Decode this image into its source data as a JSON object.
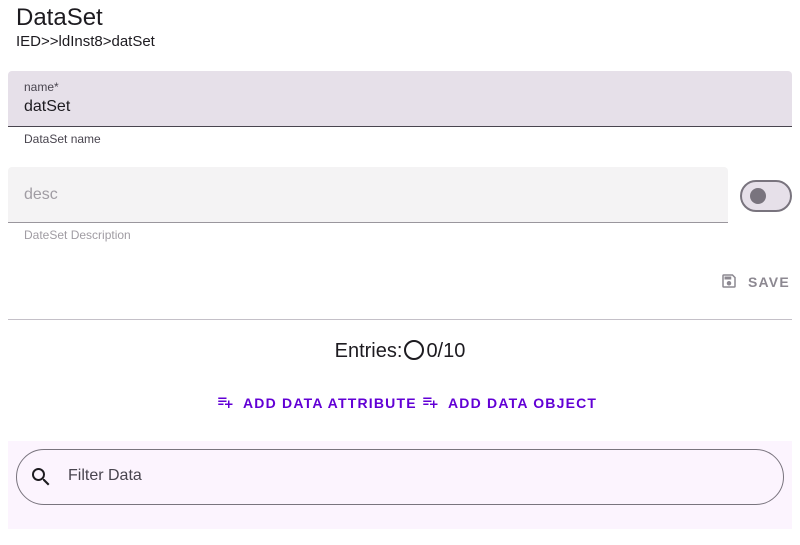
{
  "header": {
    "title": "DataSet",
    "breadcrumb": "IED>>ldInst8>datSet"
  },
  "form": {
    "name": {
      "label": "name*",
      "value": "datSet",
      "helper": "DataSet name"
    },
    "desc": {
      "placeholder": "desc",
      "helper": "DateSet Description",
      "toggle_on": false
    },
    "save_label": "SAVE"
  },
  "entries": {
    "label": "Entries:",
    "count": "0/10"
  },
  "actions": {
    "add_data_attribute": "ADD DATA ATTRIBUTE",
    "add_data_object": "ADD DATA OBJECT"
  },
  "filter": {
    "placeholder": "Filter Data"
  },
  "colors": {
    "accent": "#6200d5",
    "field_fill": "#e6e0e9",
    "filter_fill": "#fcf4fe"
  }
}
